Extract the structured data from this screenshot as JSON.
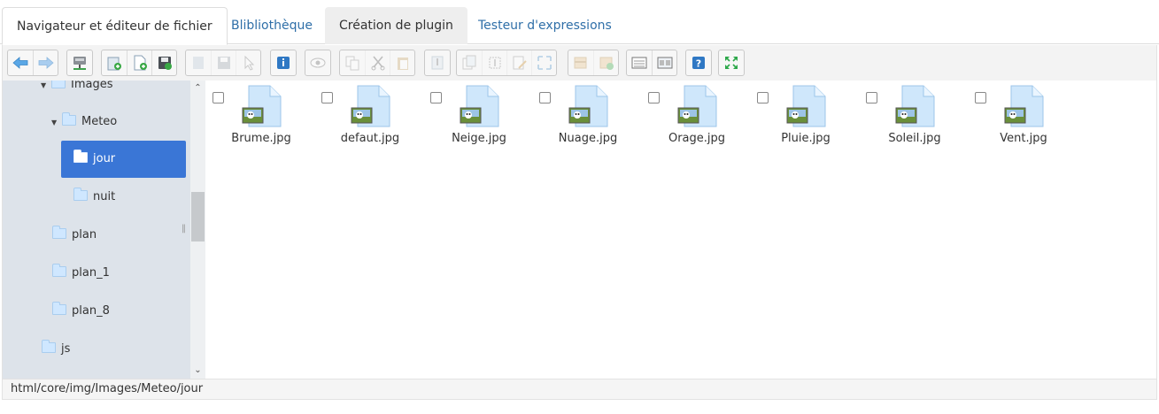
{
  "tabs": [
    {
      "label": "Navigateur et éditeur de fichier",
      "active": true
    },
    {
      "label": "Blibliothèque"
    },
    {
      "label": "Création de plugin"
    },
    {
      "label": "Testeur d'expressions"
    }
  ],
  "toolbar": {
    "buttons": [
      "back-icon",
      "forward-icon",
      "network-drive-icon",
      "new-folder-icon",
      "new-file-icon",
      "save-icon",
      "open-icon",
      "save-disabled-icon",
      "select-icon",
      "info-icon",
      "preview-icon",
      "copy-icon",
      "cut-icon",
      "paste-icon",
      "archive-icon",
      "duplicate-icon",
      "rename-icon",
      "edit-icon",
      "resize-icon",
      "extract-icon",
      "compress-icon",
      "view-list-icon",
      "view-icons-icon",
      "help-icon",
      "fullscreen-icon"
    ]
  },
  "tree": {
    "nodes": [
      {
        "label": "Images",
        "expanded": true
      },
      {
        "label": "Meteo",
        "expanded": true
      },
      {
        "label": "jour",
        "selected": true
      },
      {
        "label": "nuit"
      },
      {
        "label": "plan"
      },
      {
        "label": "plan_1"
      },
      {
        "label": "plan_8"
      },
      {
        "label": "js"
      }
    ]
  },
  "files": [
    {
      "name": "Brume.jpg"
    },
    {
      "name": "defaut.jpg"
    },
    {
      "name": "Neige.jpg"
    },
    {
      "name": "Nuage.jpg"
    },
    {
      "name": "Orage.jpg"
    },
    {
      "name": "Pluie.jpg"
    },
    {
      "name": "Soleil.jpg"
    },
    {
      "name": "Vent.jpg"
    }
  ],
  "status": {
    "path": "html/core/img/Images/Meteo/jour"
  },
  "colors": {
    "link": "#2f6fa8",
    "selected": "#3a76d6",
    "tree_bg": "#dde3ea"
  }
}
